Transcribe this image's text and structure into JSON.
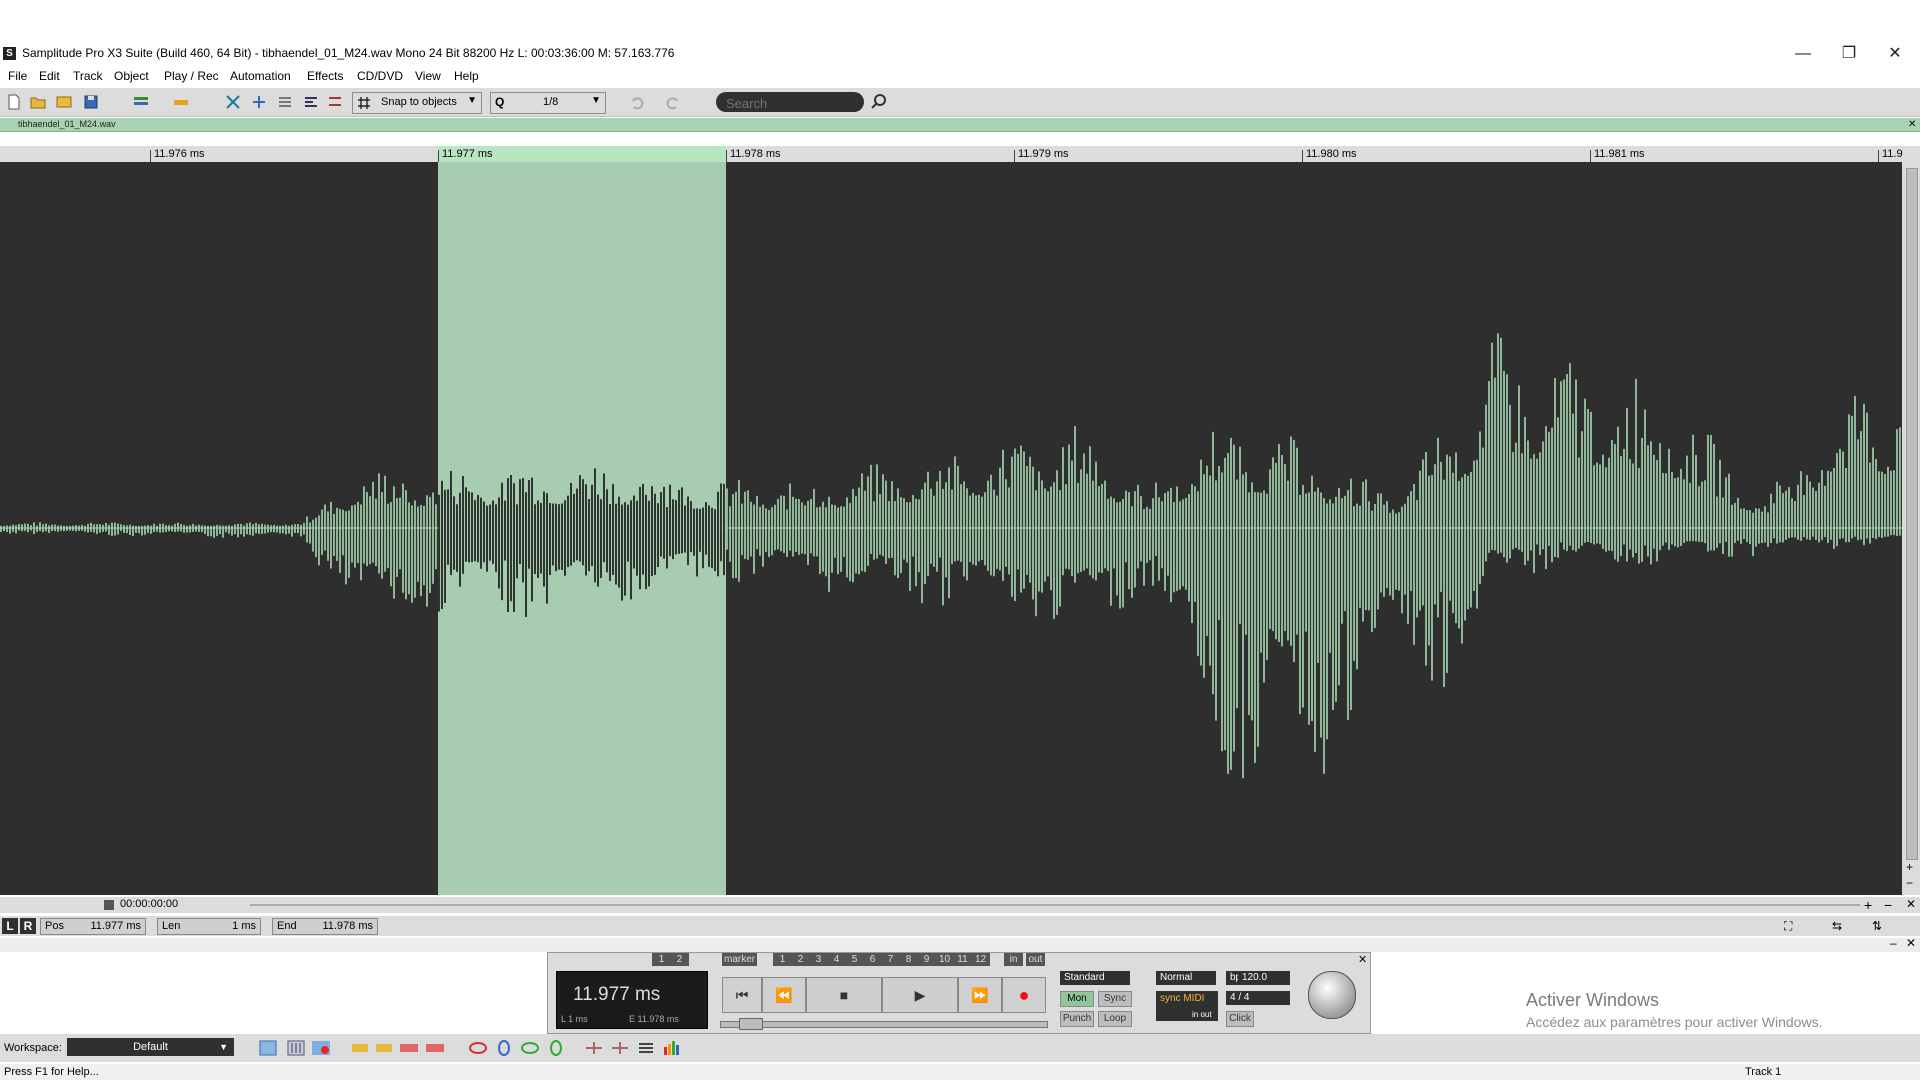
{
  "window": {
    "title": "Samplitude Pro X3 Suite (Build 460, 64 Bit)  -  tibhaendel_01_M24.wav  Mono 24 Bit 88200 Hz L: 00:03:36:00 M: 57.163.776",
    "minimize": "—",
    "maximize": "❐",
    "close": "✕"
  },
  "menu": [
    "File",
    "Edit",
    "Track",
    "Object",
    "Play / Rec",
    "Automation",
    "Effects",
    "CD/DVD",
    "View",
    "Help"
  ],
  "toolbar": {
    "snap_label": "Snap to objects",
    "quantize_value": "1/8",
    "search_placeholder": "Search"
  },
  "object_tab": {
    "name": "tibhaendel_01_M24.wav",
    "close": "✕"
  },
  "ruler": {
    "ticks": [
      "11.976 ms",
      "11.977 ms",
      "11.978 ms",
      "11.979 ms",
      "11.980 ms",
      "11.981 ms",
      "11.9"
    ]
  },
  "time_zero": "00:00:00:00",
  "position_bar": {
    "l": "L",
    "r": "R",
    "pos_label": "Pos",
    "pos_value": "11.977 ms",
    "len_label": "Len",
    "len_value": "1 ms",
    "end_label": "End",
    "end_value": "11.978 ms"
  },
  "transport": {
    "markers": [
      "1",
      "2",
      "marker",
      "1",
      "2",
      "3",
      "4",
      "5",
      "6",
      "7",
      "8",
      "9",
      "10",
      "11",
      "12",
      "in",
      "out"
    ],
    "time_main": "11.977 ms",
    "time_l": "L      1 ms",
    "time_e": "E     11.978 ms",
    "mode": "Standard",
    "mon": "Mon",
    "sync": "Sync",
    "punch": "Punch",
    "loop": "Loop",
    "normal": "Normal",
    "bpm_label": "bpm",
    "bpm_value": "120.0",
    "time_sig": "4 / 4",
    "sync_midi": "sync MIDI",
    "in_out": "in out",
    "click": "Click"
  },
  "watermark": {
    "line1": "Activer Windows",
    "line2": "Accédez aux paramètres pour activer Windows."
  },
  "workspace": {
    "label": "Workspace:",
    "value": "Default"
  },
  "status": {
    "left": "Press F1 for Help...",
    "right": "Track 1"
  },
  "colors": {
    "waveform": "#a9d9b4",
    "background": "#2d2e2d",
    "selection": "#a7ccb0"
  }
}
